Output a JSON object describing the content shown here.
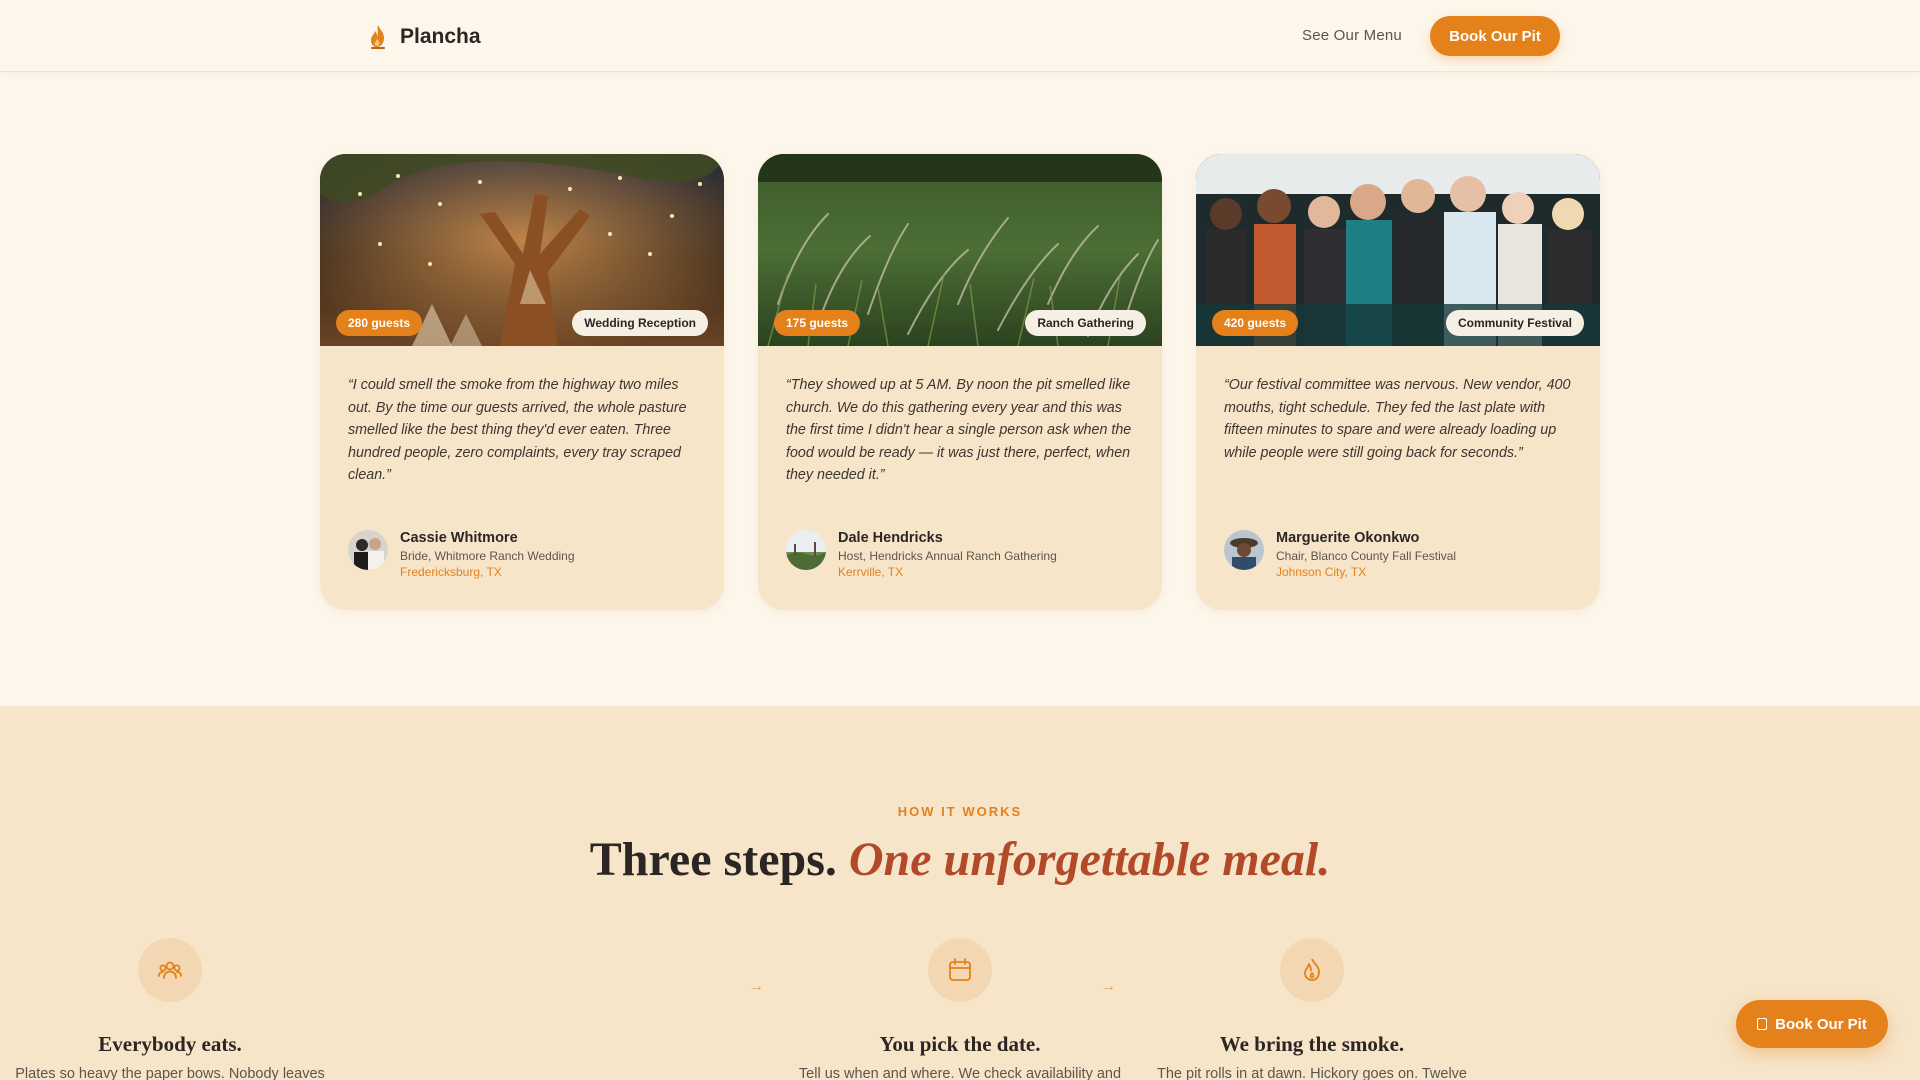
{
  "header": {
    "brand": "Plancha",
    "brand_icon": "flame-icon",
    "nav_link": "See Our Menu",
    "cta": "Book Our Pit"
  },
  "testimonials": [
    {
      "guests": "280 guests",
      "event_type": "Wedding Reception",
      "image": "string lights in a tree at night",
      "quote": "“I could smell the smoke from the highway two miles out. By the time our guests arrived, the whole pasture smelled like the best thing they'd ever eaten. Three hundred people, zero complaints, every tray scraped clean.”",
      "name": "Cassie Whitmore",
      "role": "Bride, Whitmore Ranch Wedding",
      "location": "Fredericksburg, TX"
    },
    {
      "guests": "175 guests",
      "event_type": "Ranch Gathering",
      "image": "tall grass field",
      "quote": "“They showed up at 5 AM. By noon the pit smelled like church. We do this gathering every year and this was the first time I didn't hear a single person ask when the food would be ready — it was just there, perfect, when they needed it.”",
      "name": "Dale Hendricks",
      "role": "Host, Hendricks Annual Ranch Gathering",
      "location": "Kerrville, TX"
    },
    {
      "guests": "420 guests",
      "event_type": "Community Festival",
      "image": "festival crowd",
      "quote": "“Our festival committee was nervous. New vendor, 400 mouths, tight schedule. They fed the last plate with fifteen minutes to spare and were already loading up while people were still going back for seconds.”",
      "name": "Marguerite Okonkwo",
      "role": "Chair, Blanco County Fall Festival",
      "location": "Johnson City, TX"
    }
  ],
  "how_it_works": {
    "eyebrow": "HOW IT WORKS",
    "title_main": "Three steps.",
    "title_accent": "One unforgettable meal.",
    "steps": [
      {
        "icon": "calendar-icon",
        "title": "You pick the date.",
        "text": "Tell us when and where. We check availability and"
      },
      {
        "icon": "flame-icon",
        "title": "We bring the smoke.",
        "text": "The pit rolls in at dawn. Hickory goes on. Twelve"
      },
      {
        "icon": "people-icon",
        "title": "Everybody eats.",
        "text": "Plates so heavy the paper bows. Nobody leaves"
      }
    ],
    "arrow": "→"
  },
  "floating_cta": "Book Our Pit",
  "colors": {
    "accent": "#e5811a",
    "accent_text": "#b24a2a",
    "page_bg": "#fdf6ea",
    "card_bg": "#f6e5c9"
  }
}
